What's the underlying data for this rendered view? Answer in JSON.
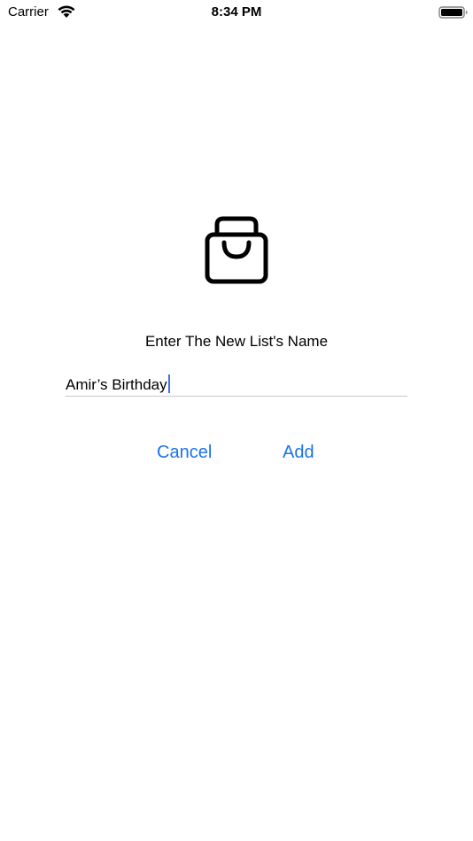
{
  "status_bar": {
    "carrier": "Carrier",
    "time": "8:34 PM",
    "wifi_icon": "wifi-icon",
    "battery_icon": "battery-full-icon"
  },
  "main": {
    "icon": "shopping-bag-icon",
    "prompt": "Enter The New List's Name",
    "list_name_value": "Amir’s Birthday",
    "cancel_label": "Cancel",
    "add_label": "Add"
  },
  "colors": {
    "accent": "#1a73e8",
    "caret": "#3d6ff0",
    "underline": "#c8c8cc"
  }
}
